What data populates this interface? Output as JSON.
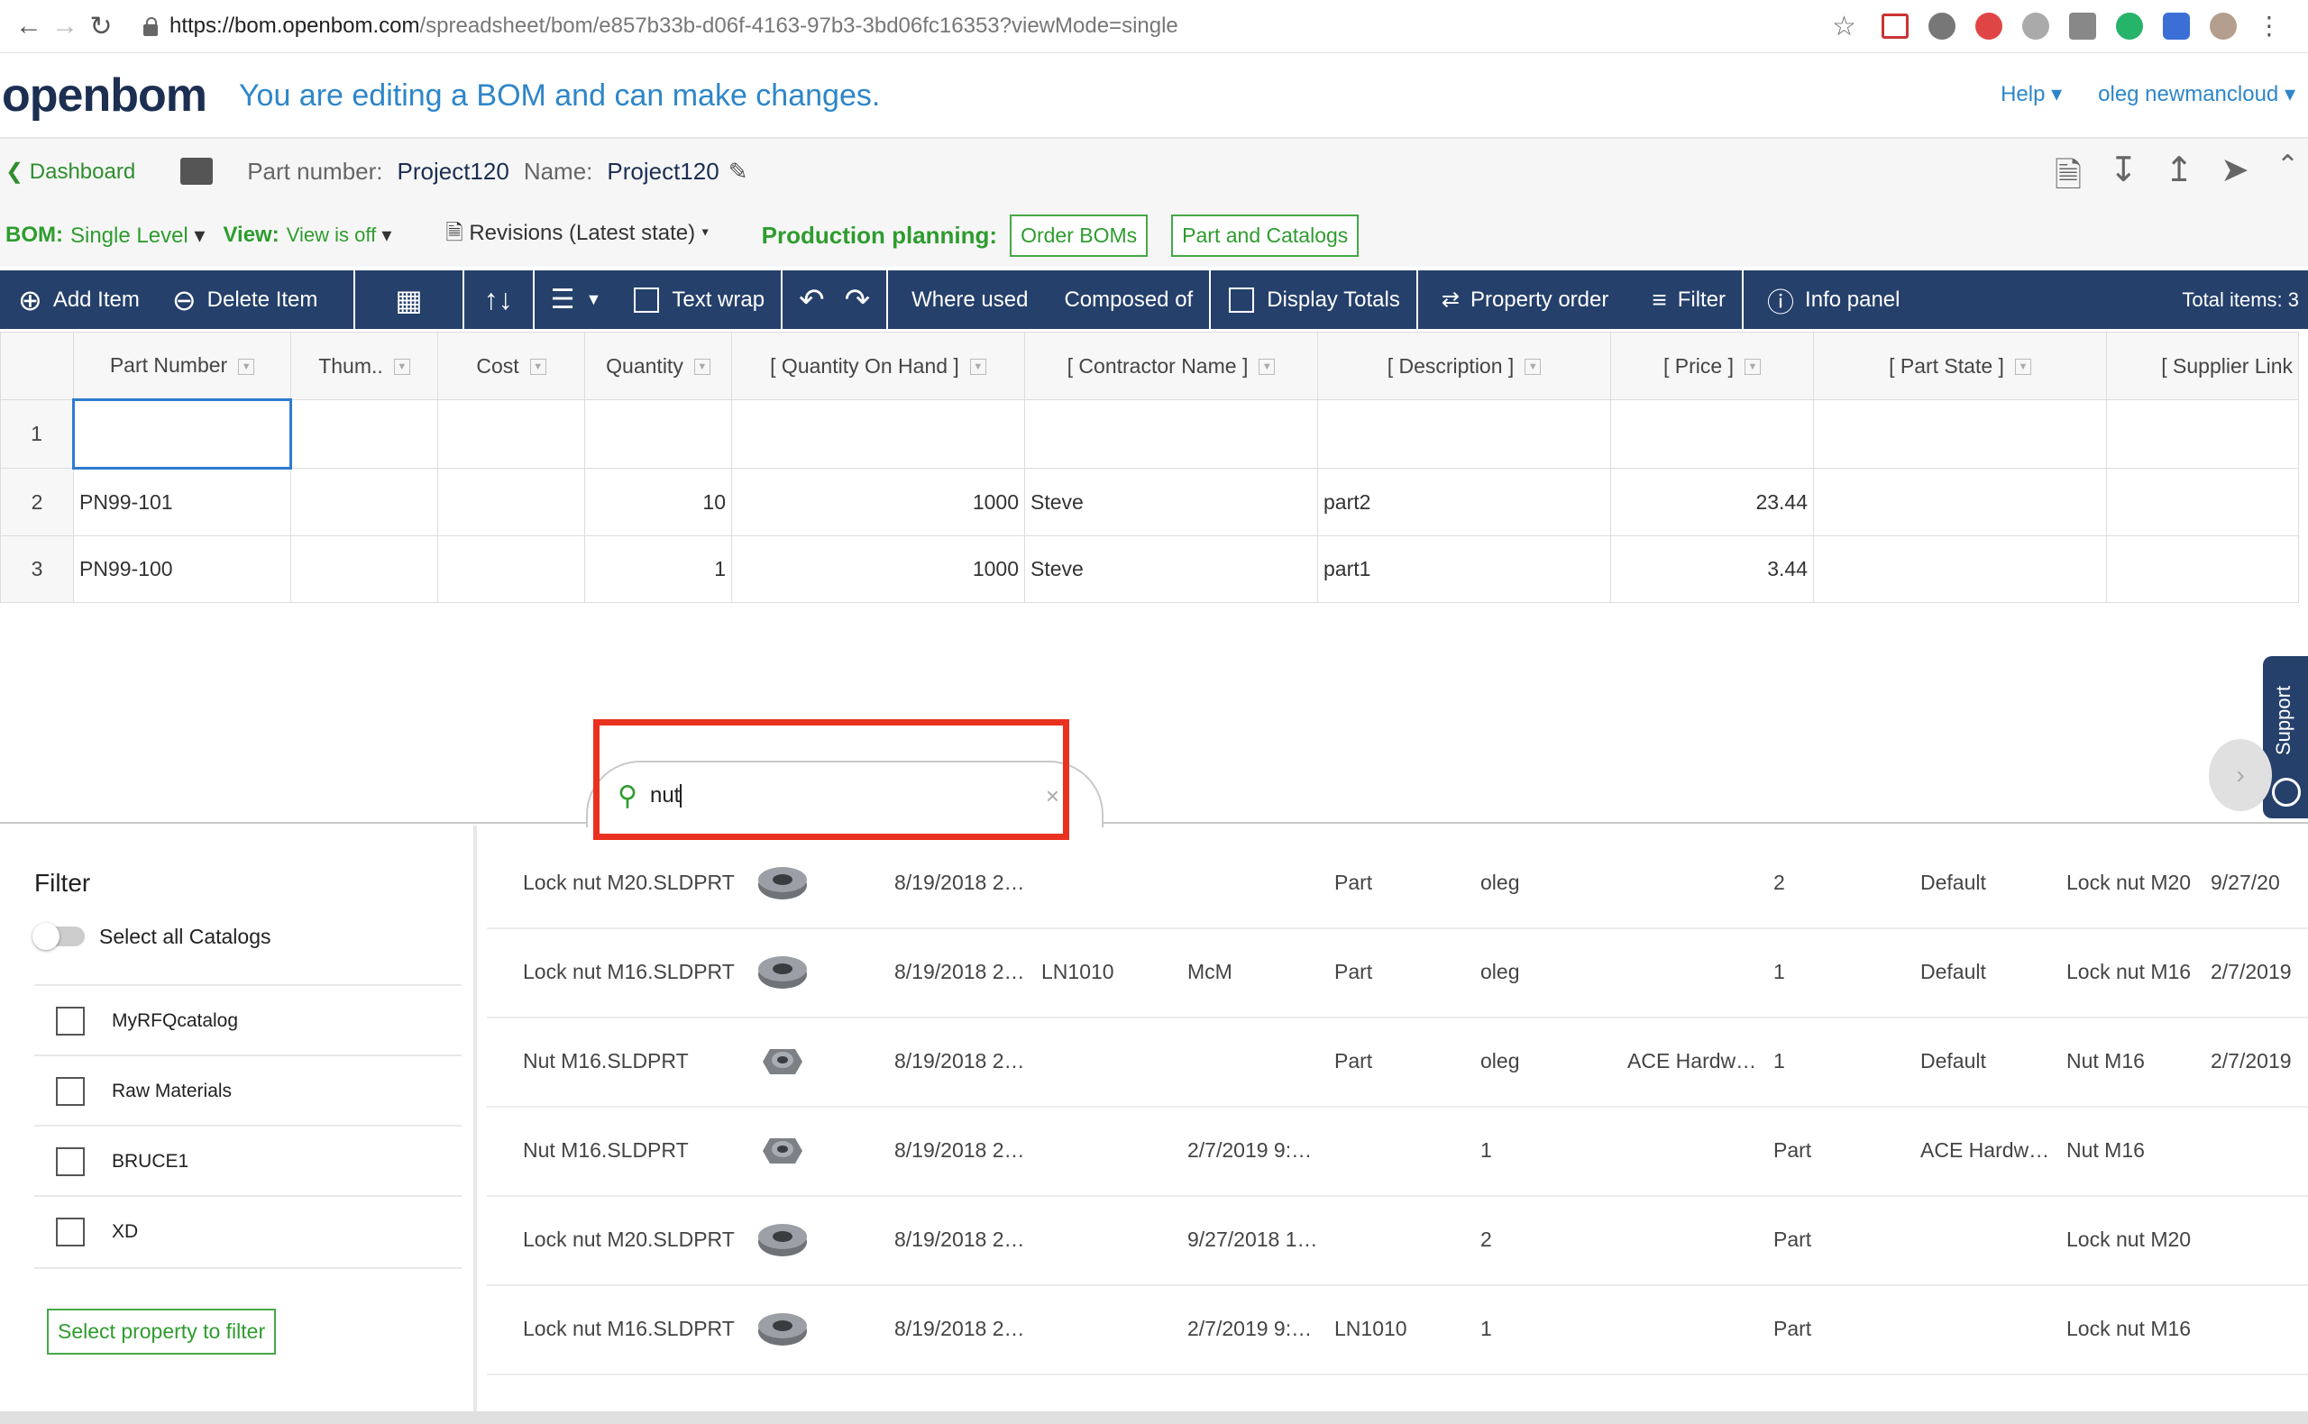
{
  "browser": {
    "url_host": "https://bom.openbom.com",
    "url_path": "/spreadsheet/bom/e857b33b-d06f-4163-97b3-3bd06fc16353?viewMode=single"
  },
  "header": {
    "logo": "openbom",
    "edit_message": "You are editing a BOM and can make changes.",
    "help": "Help",
    "user": "oleg newmancloud"
  },
  "partbar": {
    "back": "Dashboard",
    "part_number_label": "Part number:",
    "part_number": "Project120",
    "name_label": "Name:",
    "name": "Project120"
  },
  "bombar": {
    "bom_label": "BOM:",
    "bom_value": "Single Level",
    "view_label": "View:",
    "view_value": "View is off",
    "revisions": "Revisions (Latest state)",
    "production_label": "Production planning:",
    "order_boms": "Order BOMs",
    "part_catalogs": "Part and Catalogs"
  },
  "toolbar": {
    "add_item": "Add Item",
    "delete_item": "Delete Item",
    "text_wrap": "Text wrap",
    "where_used": "Where used",
    "composed_of": "Composed of",
    "display_totals": "Display Totals",
    "property_order": "Property order",
    "filter": "Filter",
    "info_panel": "Info panel",
    "total_items": "Total items: 3"
  },
  "grid": {
    "columns": [
      "Part Number",
      "Thum..",
      "Cost",
      "Quantity",
      "[ Quantity On Hand ]",
      "[ Contractor Name ]",
      "[ Description ]",
      "[ Price ]",
      "[ Part State ]",
      "[ Supplier Link"
    ],
    "rows": [
      {
        "n": "1",
        "part": "",
        "qty": "",
        "onhand": "",
        "contractor": "",
        "desc": "",
        "price": ""
      },
      {
        "n": "2",
        "part": "PN99-101",
        "qty": "10",
        "onhand": "1000",
        "contractor": "Steve",
        "desc": "part2",
        "price": "23.44"
      },
      {
        "n": "3",
        "part": "PN99-100",
        "qty": "1",
        "onhand": "1000",
        "contractor": "Steve",
        "desc": "part1",
        "price": "3.44"
      }
    ]
  },
  "search": {
    "value": "nut"
  },
  "support": "Support",
  "filter": {
    "title": "Filter",
    "select_all": "Select all Catalogs",
    "catalogs": [
      "MyRFQcatalog",
      "Raw Materials",
      "BRUCE1",
      "XD"
    ],
    "select_property": "Select property to filter"
  },
  "results": [
    [
      "Lock nut M20.SLDPRT",
      "8/19/2018 2…",
      "",
      "",
      "Part",
      "oleg",
      "",
      "2",
      "Default",
      "Lock nut M20",
      "9/27/20"
    ],
    [
      "Lock nut M16.SLDPRT",
      "8/19/2018 2…",
      "LN1010",
      "McM",
      "Part",
      "oleg",
      "",
      "1",
      "Default",
      "Lock nut M16",
      "2/7/2019"
    ],
    [
      "Nut M16.SLDPRT",
      "8/19/2018 2…",
      "",
      "",
      "Part",
      "oleg",
      "ACE Hardw…",
      "1",
      "Default",
      "Nut M16",
      "2/7/2019"
    ],
    [
      "Nut M16.SLDPRT",
      "8/19/2018 2…",
      "",
      "2/7/2019 9:…",
      "1",
      "",
      "",
      "Part",
      "ACE Hardw…",
      "Nut M16",
      ""
    ],
    [
      "Lock nut M20.SLDPRT",
      "8/19/2018 2…",
      "",
      "9/27/2018 1…",
      "2",
      "",
      "",
      "Part",
      "",
      "Lock nut M20",
      ""
    ],
    [
      "Lock nut M16.SLDPRT",
      "8/19/2018 2…",
      "",
      "2/7/2019 9:…",
      "LN1010",
      "1",
      "",
      "Part",
      "",
      "Lock nut M16",
      ""
    ]
  ],
  "colors": {
    "navy": "#25406b",
    "green": "#2e9c2e",
    "blue": "#2e86c9",
    "red_highlight": "#e8321f"
  }
}
